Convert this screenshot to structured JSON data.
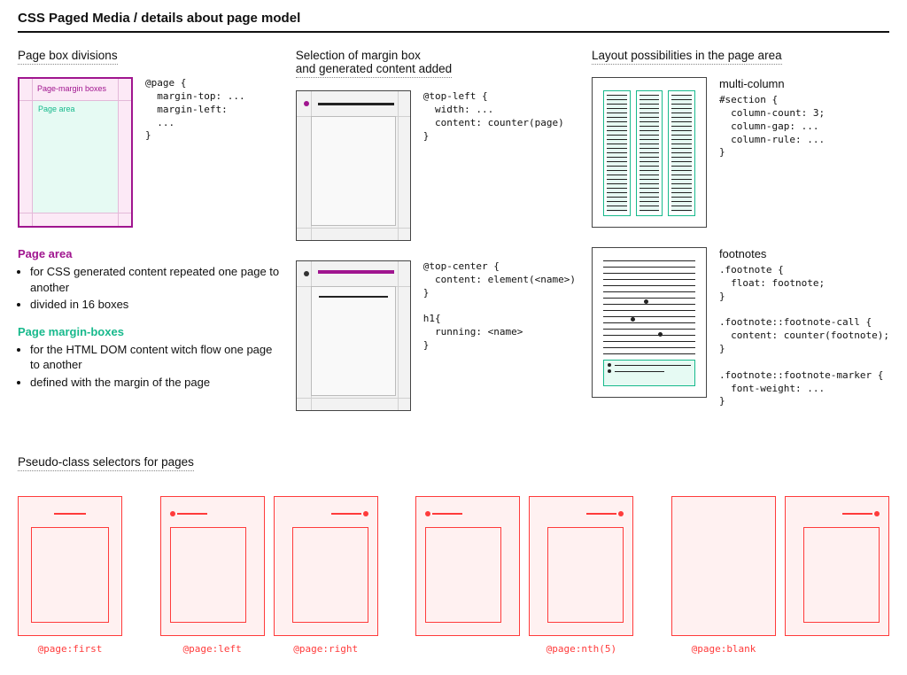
{
  "title": "CSS Paged Media / details about page model",
  "col1": {
    "heading": "Page box divisions",
    "label_margin_boxes": "Page-margin boxes",
    "label_page_area": "Page area",
    "code": "@page {\n  margin-top: ...\n  margin-left:\n  ...\n}",
    "desc_pa_head": "Page area",
    "desc_pa_items": [
      "for CSS generated content repeated one page to another",
      "divided in 16 boxes"
    ],
    "desc_pm_head": "Page margin-boxes",
    "desc_pm_items": [
      "for the HTML DOM content witch flow one page to another",
      "defined with the margin of the page"
    ]
  },
  "col2": {
    "heading": "Selection of margin box\nand generated content added",
    "code1": "@top-left {\n  width: ...\n  content: counter(page)\n}",
    "code2": "@top-center {\n  content: element(<name>)\n}\n\nh1{\n  running: <name>\n}"
  },
  "col3": {
    "heading": "Layout possibilities in the page area",
    "mc_head": "multi-column",
    "mc_code": "#section {\n  column-count: 3;\n  column-gap: ...\n  column-rule: ...\n}",
    "fn_head": "footnotes",
    "fn_code": ".footnote {\n  float: footnote;\n}\n\n.footnote::footnote-call {\n  content: counter(footnote);\n}\n\n.footnote::footnote-marker {\n  font-weight: ...\n}"
  },
  "pseudo": {
    "heading": "Pseudo-class selectors for pages",
    "labels": {
      "first": "@page:first",
      "left": "@page:left",
      "right": "@page:right",
      "nth": "@page:nth(5)",
      "blank": "@page:blank"
    }
  }
}
